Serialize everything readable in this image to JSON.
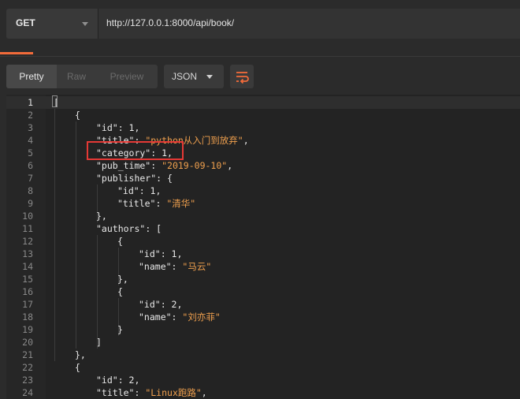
{
  "request": {
    "method": "GET",
    "url": "http://127.0.0.1:8000/api/book/"
  },
  "toolbar": {
    "pretty_label": "Pretty",
    "raw_label": "Raw",
    "preview_label": "Preview",
    "format_label": "JSON",
    "wrap_icon": "wrap-lines-icon"
  },
  "colors": {
    "accent": "#f26b3a",
    "string": "#f0a04e",
    "highlight": "#e53935"
  },
  "code_lines": [
    {
      "num": "1",
      "indent": 0,
      "tokens": [
        [
          "p",
          "["
        ]
      ]
    },
    {
      "num": "2",
      "indent": 1,
      "tokens": [
        [
          "p",
          "{"
        ]
      ]
    },
    {
      "num": "3",
      "indent": 2,
      "tokens": [
        [
          "k",
          "\"id\""
        ],
        [
          "p",
          ": 1,"
        ]
      ]
    },
    {
      "num": "4",
      "indent": 2,
      "tokens": [
        [
          "k",
          "\"title\""
        ],
        [
          "p",
          ": "
        ],
        [
          "s",
          "\"python从入门到放弃\""
        ],
        [
          "p",
          ","
        ]
      ]
    },
    {
      "num": "5",
      "indent": 2,
      "tokens": [
        [
          "k",
          "\"category\""
        ],
        [
          "p",
          ": 1,"
        ]
      ]
    },
    {
      "num": "6",
      "indent": 2,
      "tokens": [
        [
          "k",
          "\"pub_time\""
        ],
        [
          "p",
          ": "
        ],
        [
          "s",
          "\"2019-09-10\""
        ],
        [
          "p",
          ","
        ]
      ]
    },
    {
      "num": "7",
      "indent": 2,
      "tokens": [
        [
          "k",
          "\"publisher\""
        ],
        [
          "p",
          ": {"
        ]
      ]
    },
    {
      "num": "8",
      "indent": 3,
      "tokens": [
        [
          "k",
          "\"id\""
        ],
        [
          "p",
          ": 1,"
        ]
      ]
    },
    {
      "num": "9",
      "indent": 3,
      "tokens": [
        [
          "k",
          "\"title\""
        ],
        [
          "p",
          ": "
        ],
        [
          "s",
          "\"清华\""
        ]
      ]
    },
    {
      "num": "10",
      "indent": 2,
      "tokens": [
        [
          "p",
          "},"
        ]
      ]
    },
    {
      "num": "11",
      "indent": 2,
      "tokens": [
        [
          "k",
          "\"authors\""
        ],
        [
          "p",
          ": ["
        ]
      ]
    },
    {
      "num": "12",
      "indent": 3,
      "tokens": [
        [
          "p",
          "{"
        ]
      ]
    },
    {
      "num": "13",
      "indent": 4,
      "tokens": [
        [
          "k",
          "\"id\""
        ],
        [
          "p",
          ": 1,"
        ]
      ]
    },
    {
      "num": "14",
      "indent": 4,
      "tokens": [
        [
          "k",
          "\"name\""
        ],
        [
          "p",
          ": "
        ],
        [
          "s",
          "\"马云\""
        ]
      ]
    },
    {
      "num": "15",
      "indent": 3,
      "tokens": [
        [
          "p",
          "},"
        ]
      ]
    },
    {
      "num": "16",
      "indent": 3,
      "tokens": [
        [
          "p",
          "{"
        ]
      ]
    },
    {
      "num": "17",
      "indent": 4,
      "tokens": [
        [
          "k",
          "\"id\""
        ],
        [
          "p",
          ": 2,"
        ]
      ]
    },
    {
      "num": "18",
      "indent": 4,
      "tokens": [
        [
          "k",
          "\"name\""
        ],
        [
          "p",
          ": "
        ],
        [
          "s",
          "\"刘亦菲\""
        ]
      ]
    },
    {
      "num": "19",
      "indent": 3,
      "tokens": [
        [
          "p",
          "}"
        ]
      ]
    },
    {
      "num": "20",
      "indent": 2,
      "tokens": [
        [
          "p",
          "]"
        ]
      ]
    },
    {
      "num": "21",
      "indent": 1,
      "tokens": [
        [
          "p",
          "},"
        ]
      ]
    },
    {
      "num": "22",
      "indent": 1,
      "tokens": [
        [
          "p",
          "{"
        ]
      ]
    },
    {
      "num": "23",
      "indent": 2,
      "tokens": [
        [
          "k",
          "\"id\""
        ],
        [
          "p",
          ": 2,"
        ]
      ]
    },
    {
      "num": "24",
      "indent": 2,
      "tokens": [
        [
          "k",
          "\"title\""
        ],
        [
          "p",
          ": "
        ],
        [
          "s",
          "\"Linux跑路\""
        ],
        [
          "p",
          ","
        ]
      ]
    }
  ]
}
